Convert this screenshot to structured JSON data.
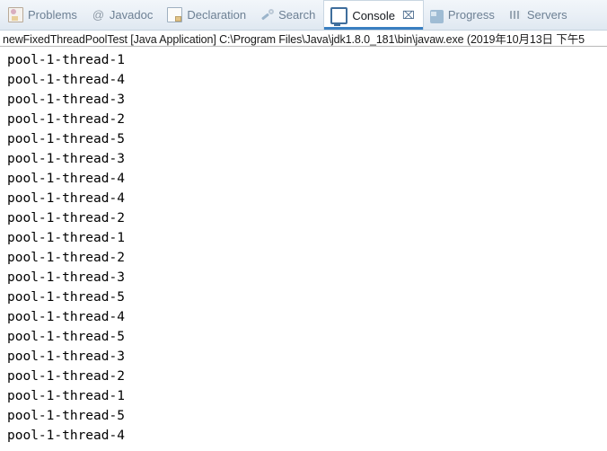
{
  "tabs": [
    {
      "label": "Problems",
      "icon": "problems-icon",
      "active": false,
      "closable": false
    },
    {
      "label": "Javadoc",
      "icon": "javadoc-icon",
      "active": false,
      "closable": false
    },
    {
      "label": "Declaration",
      "icon": "declaration-icon",
      "active": false,
      "closable": false
    },
    {
      "label": "Search",
      "icon": "search-icon",
      "active": false,
      "closable": false
    },
    {
      "label": "Console",
      "icon": "console-icon",
      "active": true,
      "closable": true
    },
    {
      "label": "Progress",
      "icon": "progress-icon",
      "active": false,
      "closable": false
    },
    {
      "label": "Servers",
      "icon": "servers-icon",
      "active": false,
      "closable": false
    }
  ],
  "close_glyph": "⌧",
  "status": {
    "text": "newFixedThreadPoolTest [Java Application] C:\\Program Files\\Java\\jdk1.8.0_181\\bin\\javaw.exe (2019年10月13日 下午5"
  },
  "console": {
    "lines": [
      "pool-1-thread-1",
      "pool-1-thread-4",
      "pool-1-thread-3",
      "pool-1-thread-2",
      "pool-1-thread-5",
      "pool-1-thread-3",
      "pool-1-thread-4",
      "pool-1-thread-4",
      "pool-1-thread-2",
      "pool-1-thread-1",
      "pool-1-thread-2",
      "pool-1-thread-3",
      "pool-1-thread-5",
      "pool-1-thread-4",
      "pool-1-thread-5",
      "pool-1-thread-3",
      "pool-1-thread-2",
      "pool-1-thread-1",
      "pool-1-thread-5",
      "pool-1-thread-4"
    ]
  },
  "colors": {
    "accent": "#3a7fc1",
    "tab_inactive_text": "#6d8094",
    "tab_active_text": "#15191e",
    "console_text": "#000000",
    "tabbar_bg": "#e9eff6"
  }
}
